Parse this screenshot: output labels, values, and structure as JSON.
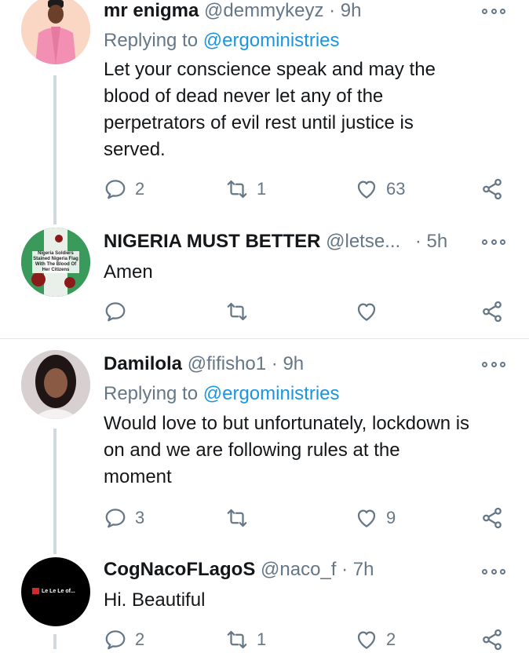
{
  "tweets": [
    {
      "name": "mr enigma",
      "handle": "@demmykeyz",
      "dot": "·",
      "time": "9h",
      "replying_prefix": "Replying to",
      "replying_to": "@ergoministries",
      "text_lines": [
        "Let your conscience speak and may the",
        "blood of dead never let any of the",
        "perpetrators of evil rest until justice is",
        "served."
      ],
      "replies": "2",
      "retweets": "1",
      "likes": "63"
    },
    {
      "name": "NIGERIA MUST BETTER",
      "handle": "@letse...",
      "dot": "·",
      "time": "5h",
      "text_lines": [
        "Amen"
      ],
      "replies": "",
      "retweets": "",
      "likes": ""
    },
    {
      "name": "Damilola",
      "handle": "@fifisho1",
      "dot": "·",
      "time": "9h",
      "replying_prefix": "Replying to",
      "replying_to": "@ergoministries",
      "text_lines": [
        "Would love to but unfortunately, lockdown is",
        "on and we are following rules at the",
        "moment"
      ],
      "replies": "3",
      "retweets": "",
      "likes": "9"
    },
    {
      "name": "CogNacoFLagoS",
      "handle": "@naco_f",
      "dot": "·",
      "time": "7h",
      "text_lines": [
        "Hi. Beautiful"
      ],
      "replies": "2",
      "retweets": "1",
      "likes": "2"
    }
  ],
  "avatar2_caption": [
    "Nigeria Soldiers",
    "Stained Nigeria Flag",
    "With The Blood Of",
    "Her Citizens"
  ],
  "avatar4_caption": "Le Le Le of...",
  "colors": {
    "link": "#1b95e0",
    "muted": "#657786",
    "text": "#14171a",
    "thread_line": "#cfd9de"
  },
  "icons": [
    "reply-icon",
    "retweet-icon",
    "like-icon",
    "share-icon",
    "more-icon"
  ]
}
